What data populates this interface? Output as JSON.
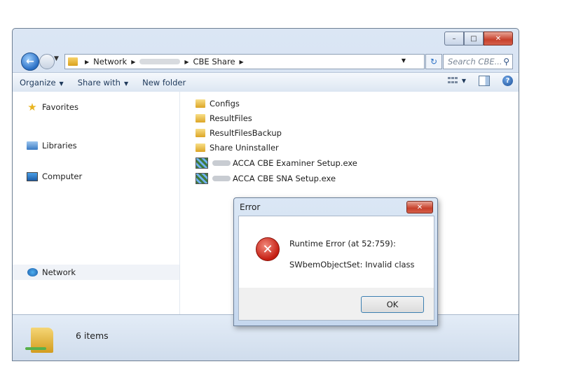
{
  "window": {
    "caption_buttons": {
      "minimize": "–",
      "maximize": "□",
      "close": "✕"
    }
  },
  "address": {
    "crumbs": [
      "Network",
      "CBE Share"
    ],
    "search_placeholder": "Search CBE..."
  },
  "toolbar": {
    "organize": "Organize",
    "share_with": "Share with",
    "new_folder": "New folder"
  },
  "nav": {
    "items": [
      "Favorites",
      "Libraries",
      "Computer",
      "Network"
    ],
    "selected": "Network"
  },
  "files": [
    {
      "name": "Configs",
      "type": "folder"
    },
    {
      "name": "ResultFiles",
      "type": "folder"
    },
    {
      "name": "ResultFilesBackup",
      "type": "folder"
    },
    {
      "name": "Share Uninstaller",
      "type": "folder"
    },
    {
      "name": "ACCA CBE Examiner Setup.exe",
      "type": "exe"
    },
    {
      "name": "ACCA CBE SNA Setup.exe",
      "type": "exe"
    }
  ],
  "status": {
    "count": "6 items"
  },
  "dialog": {
    "title": "Error",
    "line1": "Runtime Error (at 52:759):",
    "line2": "SWbemObjectSet: Invalid class",
    "ok": "OK",
    "close": "✕"
  },
  "icons": {
    "back": "back-arrow-icon",
    "error": "error-icon"
  },
  "colors": {
    "accent": "#2a6fc4",
    "error": "#c41d11",
    "close": "#c7402b"
  }
}
